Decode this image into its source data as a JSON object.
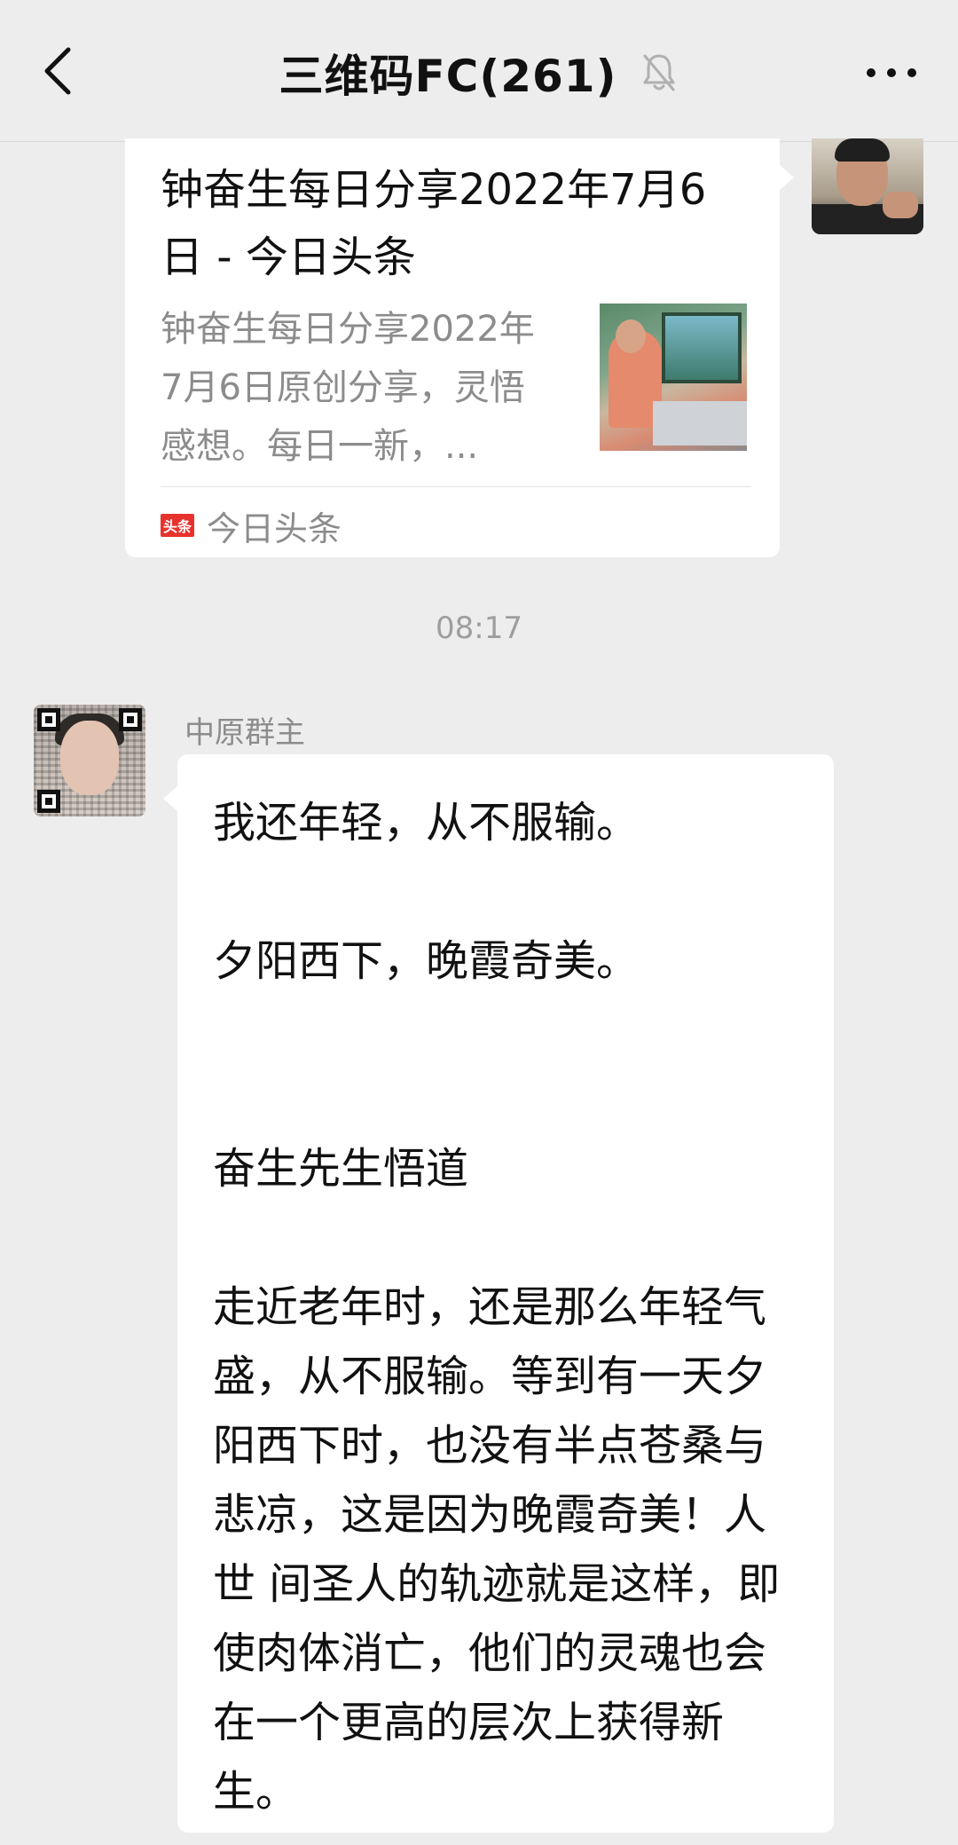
{
  "header": {
    "title": "三维码FC(261)",
    "back_icon": "chevron-left-icon",
    "mute_icon": "bell-muted-icon",
    "more_icon": "more-dots-icon"
  },
  "link_card": {
    "title": "钟奋生每日分享2022年7月6日 - 今日头条",
    "description": "钟奋生每日分享2022年7月6日原创分享，灵悟感想。每日一新，...",
    "source_logo_text": "头条",
    "source_name": "今日头条"
  },
  "timestamp": "08:17",
  "message": {
    "sender": "中原群主",
    "text": "我还年轻，从不服输。\n\n夕阳西下，晚霞奇美。\n\n\n奋生先生悟道\n\n走近老年时，还是那么年轻气盛，从不服输。等到有一天夕阳西下时，也没有半点苍桑与悲凉，这是因为晚霞奇美！人世 间圣人的轨迹就是这样，即使肉体消亡，他们的灵魂也会在一个更高的层次上获得新生。"
  },
  "colors": {
    "background": "#ededed",
    "bubble": "#ffffff",
    "muted_text": "#8c8c8c",
    "source_logo": "#e8322e"
  }
}
